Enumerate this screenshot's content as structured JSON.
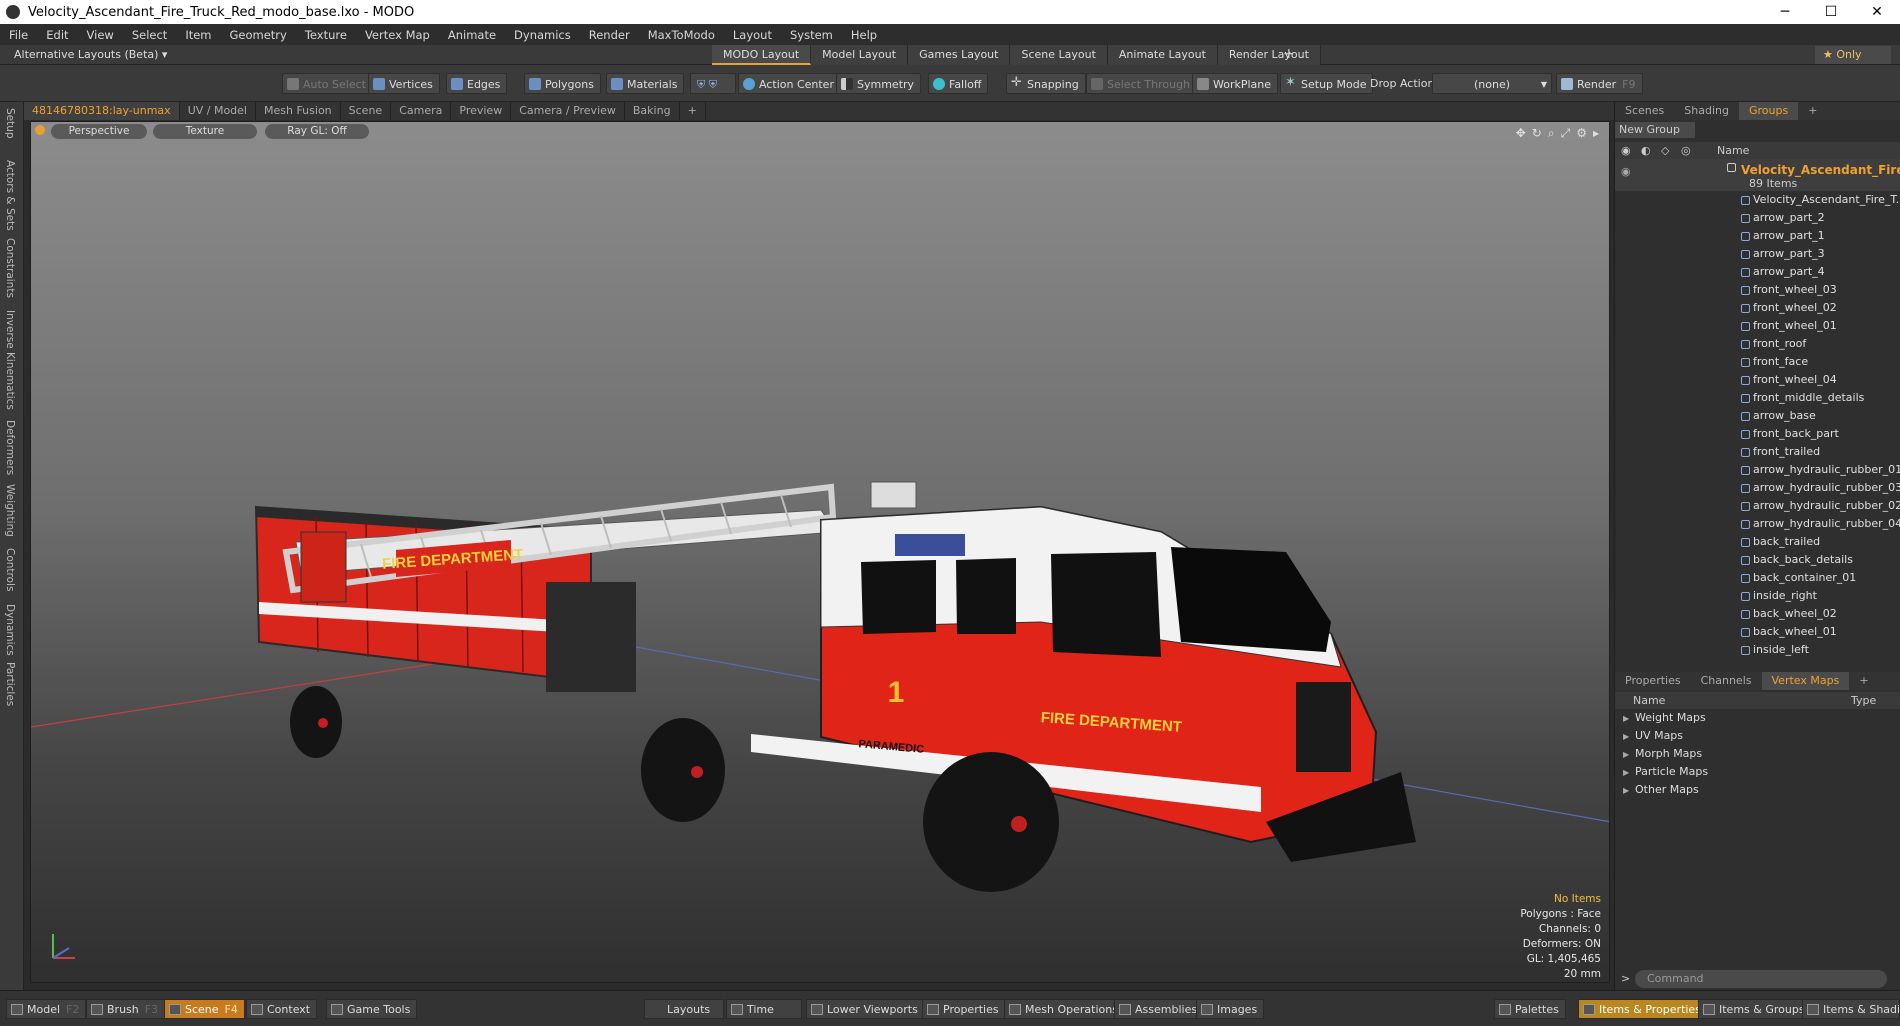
{
  "window": {
    "title": "Velocity_Ascendant_Fire_Truck_Red_modo_base.lxo - MODO",
    "minimize": "─",
    "maximize": "☐",
    "close": "✕"
  },
  "menu": [
    "File",
    "Edit",
    "View",
    "Select",
    "Item",
    "Geometry",
    "Texture",
    "Vertex Map",
    "Animate",
    "Dynamics",
    "Render",
    "MaxToModo",
    "Layout",
    "System",
    "Help"
  ],
  "layoutbar": {
    "alt_layouts": "Alternative Layouts (Beta) ▾",
    "tabs": [
      "MODO Layout",
      "Model Layout",
      "Games Layout",
      "Scene Layout",
      "Animate Layout",
      "Render Layout"
    ],
    "plus": "+",
    "only": "★ Only"
  },
  "toolbar": {
    "auto_select": "Auto Select",
    "vertices": "Vertices",
    "edges": "Edges",
    "polygons": "Polygons",
    "materials": "Materials",
    "action_center": "Action Center",
    "symmetry": "Symmetry",
    "falloff": "Falloff",
    "snapping": "Snapping",
    "select_through": "Select Through",
    "workplane": "WorkPlane",
    "setup_mode": "Setup Mode",
    "drop_action": "Drop Action",
    "drop_value": "(none)",
    "render": "Render",
    "render_key": "F9"
  },
  "left_tabs": [
    "Setup",
    "Actors & Sets",
    "Constraints",
    "Inverse Kinematics",
    "Deformers",
    "Weighting",
    "Controls",
    "Dynamics",
    "Particles"
  ],
  "viewport_tabs": [
    "48146780318:lay-unmax",
    "UV / Model",
    "Mesh Fusion",
    "Scene",
    "Camera",
    "Preview",
    "Camera / Preview",
    "Baking",
    "+"
  ],
  "viewport": {
    "view": "Perspective",
    "shading": "Texture",
    "raygl": "Ray GL: Off",
    "stats": {
      "no_items": "No Items",
      "polygons": "Polygons : Face",
      "channels": "Channels: 0",
      "deformers": "Deformers: ON",
      "gl": "GL: 1,405,465",
      "scale": "20 mm"
    },
    "truck_text": {
      "ladder": "FIRE DEPARTMENT",
      "side": "FIRE DEPARTMENT",
      "paramedic": "PARAMEDIC",
      "number": "1"
    }
  },
  "right_tabs_top": [
    "Scenes",
    "Shading",
    "Groups",
    "+"
  ],
  "groups": {
    "new_group": "New Group",
    "name_header": "Name",
    "group_name": "Velocity_Ascendant_Fire ...",
    "count": "89 Items",
    "items": [
      "Velocity_Ascendant_Fire_T...",
      "arrow_part_2",
      "arrow_part_1",
      "arrow_part_3",
      "arrow_part_4",
      "front_wheel_03",
      "front_wheel_02",
      "front_wheel_01",
      "front_roof",
      "front_face",
      "front_wheel_04",
      "front_middle_details",
      "arrow_base",
      "front_back_part",
      "front_trailed",
      "arrow_hydraulic_rubber_01",
      "arrow_hydraulic_rubber_03",
      "arrow_hydraulic_rubber_02",
      "arrow_hydraulic_rubber_04",
      "back_trailed",
      "back_back_details",
      "back_container_01",
      "inside_right",
      "back_wheel_02",
      "back_wheel_01",
      "inside_left"
    ]
  },
  "right_tabs_bottom": [
    "Properties",
    "Channels",
    "Vertex Maps",
    "+"
  ],
  "vertex_maps": {
    "name_header": "Name",
    "type_header": "Type",
    "rows": [
      "Weight Maps",
      "UV Maps",
      "Morph Maps",
      "Particle Maps",
      "Other Maps"
    ]
  },
  "command": {
    "placeholder": "Command",
    "arrow": ">"
  },
  "bottom": {
    "model": "Model",
    "model_key": "F2",
    "brush": "Brush",
    "brush_key": "F3",
    "scene": "Scene",
    "scene_key": "F4",
    "context": "Context",
    "game_tools": "Game Tools",
    "layouts": "Layouts",
    "time": "Time",
    "lower_viewports": "Lower Viewports",
    "properties": "Properties",
    "mesh_operations": "Mesh Operations",
    "assemblies": "Assemblies",
    "images": "Images",
    "palettes": "Palettes",
    "items_properties": "Items & Properties",
    "items_groups": "Items & Groups",
    "items_shading": "Items & Shadin"
  },
  "colors": {
    "accent": "#f0a030",
    "truck_red": "#e02418",
    "truck_white": "#f2f2f2"
  }
}
